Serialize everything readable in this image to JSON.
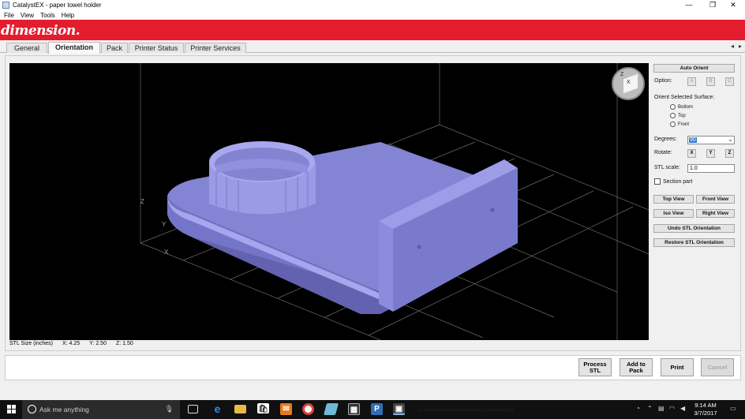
{
  "window": {
    "title": "CatalystEX - paper towel holder",
    "minimize": "—",
    "maximize": "❐",
    "close": "✕"
  },
  "menu": [
    "File",
    "View",
    "Tools",
    "Help"
  ],
  "brand": "dimension.",
  "tabs": [
    {
      "label": "General",
      "active": false
    },
    {
      "label": "Orientation",
      "active": true
    },
    {
      "label": "Pack",
      "active": false
    },
    {
      "label": "Printer Status",
      "active": false
    },
    {
      "label": "Printer Services",
      "active": false
    }
  ],
  "tab_scroll": {
    "left": "◂",
    "right": "▸"
  },
  "viewport": {
    "axis_z": "Z",
    "axis_y": "Y",
    "axis_x": "X",
    "cube_z": "Z",
    "cube_x": "X",
    "model_color": "#9b9be6"
  },
  "stl_size": {
    "label": "STL Size (inches)",
    "x": "X: 4.25",
    "y": "Y: 2.50",
    "z": "Z: 1.50"
  },
  "panel": {
    "auto_orient": "Auto Orient",
    "option_label": "Option:",
    "options": [
      "A",
      "B",
      "C"
    ],
    "orient_surface_label": "Orient Selected Surface:",
    "surfaces": [
      "Bottom",
      "Top",
      "Front"
    ],
    "degrees_label": "Degrees:",
    "degrees_value": "90",
    "rotate_label": "Rotate:",
    "rotate_axes": [
      "X",
      "Y",
      "Z"
    ],
    "scale_label": "STL scale:",
    "scale_value": "1.0",
    "section_part": "Section part",
    "top_view": "Top View",
    "front_view": "Front View",
    "iso_view": "Iso View",
    "right_view": "Right View",
    "undo_stl": "Undo STL Orientation",
    "restore_stl": "Restore STL Orientation"
  },
  "actions": {
    "process_line1": "Process",
    "process_line2": "STL",
    "add_line1": "Add to",
    "add_line2": "Pack",
    "print": "Print",
    "cancel": "Cancel"
  },
  "taskbar": {
    "search_placeholder": "Ask me anything",
    "time": "9:14 AM",
    "date": "3/7/2017"
  }
}
